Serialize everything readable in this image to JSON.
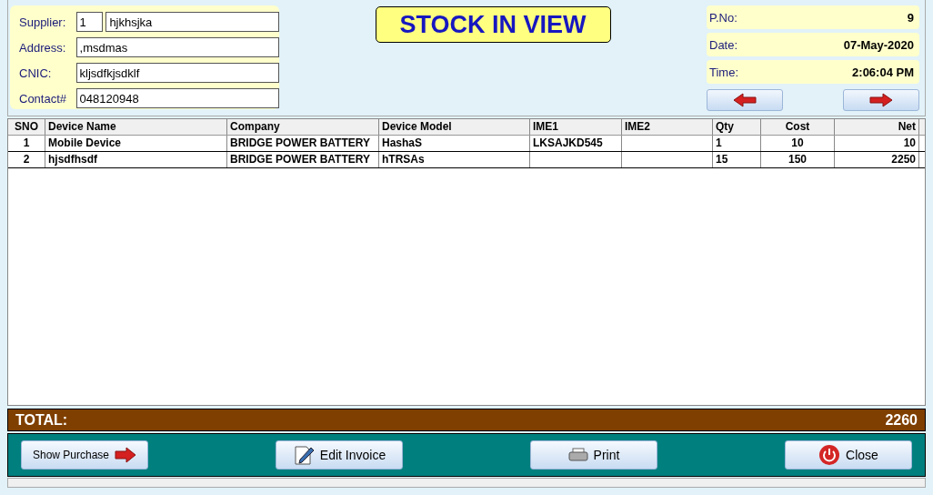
{
  "supplier": {
    "label": "Supplier:",
    "code": "1",
    "name": "hjkhsjka"
  },
  "fields": [
    {
      "label": "Address:",
      "value": ",msdmas"
    },
    {
      "label": "CNIC:",
      "value": "kljsdfkjsdklf"
    },
    {
      "label": "Contact#",
      "value": "048120948"
    }
  ],
  "title": "STOCK IN VIEW",
  "info": [
    {
      "label": "P.No:",
      "value": "9"
    },
    {
      "label": "Date:",
      "value": "07-May-2020"
    },
    {
      "label": "Time:",
      "value": "2:06:04 PM"
    }
  ],
  "table": {
    "columns": [
      "SNO",
      "Device Name",
      "Company",
      "Device Model",
      "IME1",
      "IME2",
      "Qty",
      "Cost",
      "Net"
    ],
    "rows": [
      [
        "1",
        "Mobile Device",
        "BRIDGE POWER BATTERY",
        "HashaS",
        "LKSAJKD545",
        "",
        "1",
        "10",
        "10"
      ],
      [
        "2",
        "hjsdfhsdf",
        "BRIDGE POWER BATTERY",
        "hTRSAs",
        "",
        "",
        "15",
        "150",
        "2250"
      ]
    ]
  },
  "total": {
    "label": "TOTAL:",
    "value": "2260"
  },
  "buttons": [
    {
      "label": "Show Purchase",
      "kind": "arrow"
    },
    {
      "label": "Edit Invoice",
      "kind": "edit"
    },
    {
      "label": "Print",
      "kind": "print"
    },
    {
      "label": "Close",
      "kind": "power"
    }
  ]
}
